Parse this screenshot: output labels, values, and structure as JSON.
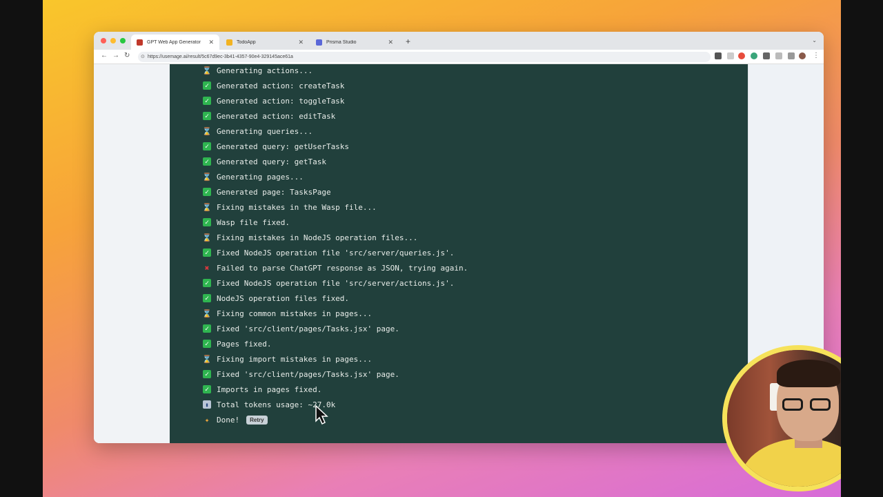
{
  "browser": {
    "tabs": [
      {
        "title": "GPT Web App Generator",
        "active": true,
        "favicon_color": "#c0392b"
      },
      {
        "title": "TodoApp",
        "active": false,
        "favicon_color": "#f2b322"
      },
      {
        "title": "Prisma Studio",
        "active": false,
        "favicon_color": "#5a67d8"
      }
    ],
    "url": "https://usemage.ai/result/5c67d9ec-3b41-4357-90e4-329145ace61a"
  },
  "log": [
    {
      "icon": "hourglass",
      "text": "Generating actions..."
    },
    {
      "icon": "check",
      "text": "Generated action: createTask"
    },
    {
      "icon": "check",
      "text": "Generated action: toggleTask"
    },
    {
      "icon": "check",
      "text": "Generated action: editTask"
    },
    {
      "icon": "hourglass",
      "text": "Generating queries..."
    },
    {
      "icon": "check",
      "text": "Generated query: getUserTasks"
    },
    {
      "icon": "check",
      "text": "Generated query: getTask"
    },
    {
      "icon": "hourglass",
      "text": "Generating pages..."
    },
    {
      "icon": "check",
      "text": "Generated page: TasksPage"
    },
    {
      "icon": "hourglass",
      "text": "Fixing mistakes in the Wasp file..."
    },
    {
      "icon": "check",
      "text": "Wasp file fixed."
    },
    {
      "icon": "hourglass",
      "text": "Fixing mistakes in NodeJS operation files..."
    },
    {
      "icon": "check",
      "text": "Fixed NodeJS operation file 'src/server/queries.js'."
    },
    {
      "icon": "error",
      "text": "Failed to parse ChatGPT response as JSON, trying again."
    },
    {
      "icon": "check",
      "text": "Fixed NodeJS operation file 'src/server/actions.js'."
    },
    {
      "icon": "check",
      "text": "NodeJS operation files fixed."
    },
    {
      "icon": "hourglass",
      "text": "Fixing common mistakes in pages..."
    },
    {
      "icon": "check",
      "text": "Fixed 'src/client/pages/Tasks.jsx' page."
    },
    {
      "icon": "check",
      "text": "Pages fixed."
    },
    {
      "icon": "hourglass",
      "text": "Fixing import mistakes in pages..."
    },
    {
      "icon": "check",
      "text": "Fixed 'src/client/pages/Tasks.jsx' page."
    },
    {
      "icon": "check",
      "text": "Imports in pages fixed."
    },
    {
      "icon": "chart",
      "text": "Total tokens usage: ~27.0k"
    }
  ],
  "done": {
    "icon": "party",
    "text": "Done!",
    "retry_label": "Retry"
  },
  "colors": {
    "terminal_bg": "#21403c",
    "success": "#2fb550",
    "error": "#e0383e"
  }
}
